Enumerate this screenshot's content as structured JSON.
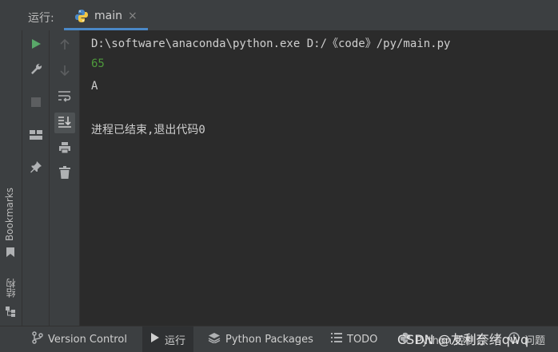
{
  "header": {
    "label": "运行:",
    "tab": {
      "title": "main",
      "close": "×",
      "icon": "python-icon"
    }
  },
  "side_strip": {
    "bookmarks_label": "Bookmarks",
    "structure_label": "结构"
  },
  "toolbar1": [
    "run-icon",
    "wrench-icon",
    "stop-icon",
    "layout-icon",
    "pin-icon"
  ],
  "toolbar2": [
    "arrow-up-icon",
    "arrow-down-icon",
    "soft-wrap-icon",
    "scroll-to-end-icon",
    "print-icon",
    "trash-icon"
  ],
  "console": {
    "command": "D:\\software\\anaconda\\python.exe D:/《code》/py/main.py",
    "output": [
      "65",
      "A"
    ],
    "exit_message": "进程已结束,退出代码0",
    "colors": {
      "numeric_output": "#4e9a3c",
      "text": "#cfcfcf"
    }
  },
  "bottom_bar": {
    "tabs": [
      {
        "label": "Version Control",
        "icon": "branch-icon"
      },
      {
        "label": "运行",
        "icon": "run-icon",
        "active": true
      },
      {
        "label": "Python Packages",
        "icon": "layers-icon"
      },
      {
        "label": "TODO",
        "icon": "list-icon"
      },
      {
        "label": "Python 控制台",
        "icon": "python-icon"
      },
      {
        "label": "问题",
        "icon": "warning-icon"
      }
    ],
    "watermark": "CSDN @友利奈绪qwq"
  }
}
